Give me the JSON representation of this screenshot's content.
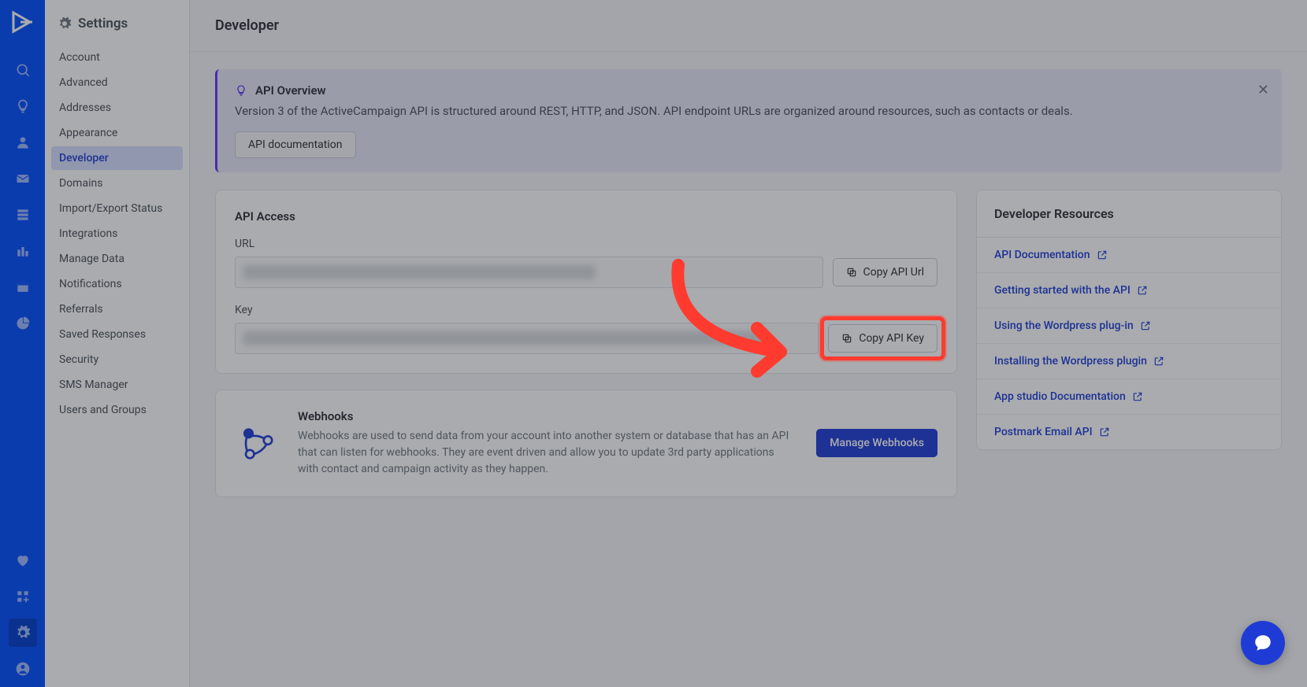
{
  "sidebar": {
    "title": "Settings",
    "items": [
      "Account",
      "Advanced",
      "Addresses",
      "Appearance",
      "Developer",
      "Domains",
      "Import/Export Status",
      "Integrations",
      "Manage Data",
      "Notifications",
      "Referrals",
      "Saved Responses",
      "Security",
      "SMS Manager",
      "Users and Groups"
    ],
    "active_index": 4
  },
  "header": {
    "title": "Developer"
  },
  "banner": {
    "title": "API Overview",
    "text": "Version 3 of the ActiveCampaign API is structured around REST, HTTP, and JSON. API endpoint URLs are organized around resources, such as contacts or deals.",
    "button": "API documentation"
  },
  "api_access": {
    "title": "API Access",
    "url_label": "URL",
    "key_label": "Key",
    "copy_url": "Copy API Url",
    "copy_key": "Copy API Key"
  },
  "webhooks": {
    "title": "Webhooks",
    "text": "Webhooks are used to send data from your account into another system or database that has an API that can listen for webhooks. They are event driven and allow you to update 3rd party applications with contact and campaign activity as they happen.",
    "button": "Manage Webhooks"
  },
  "resources": {
    "title": "Developer Resources",
    "links": [
      "API Documentation",
      "Getting started with the API",
      "Using the Wordpress plug-in",
      "Installing the Wordpress plugin",
      "App studio Documentation",
      "Postmark Email API"
    ]
  }
}
